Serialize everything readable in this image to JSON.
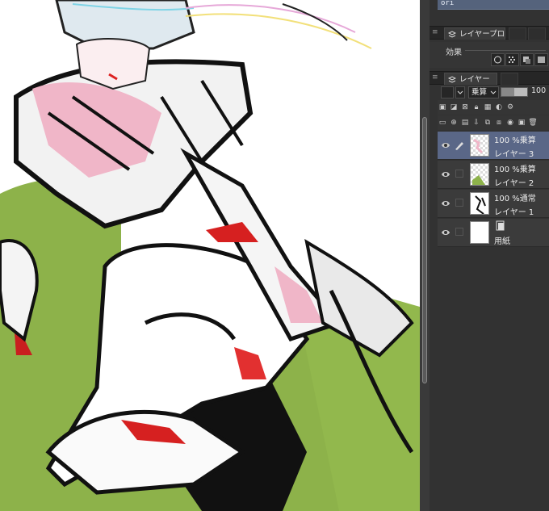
{
  "palette_top": {
    "text": "ori"
  },
  "property_panel": {
    "tab_label": "レイヤープロ",
    "effects_label": "効果"
  },
  "layer_panel": {
    "tab_label": "レイヤー",
    "blend_mode": "乗算",
    "opacity": "100"
  },
  "layers": [
    {
      "blend": "100 %乗算",
      "name": "レイヤー 3",
      "selected": true
    },
    {
      "blend": "100 %乗算",
      "name": "レイヤー 2",
      "selected": false
    },
    {
      "blend": "100 %通常",
      "name": "レイヤー 1",
      "selected": false
    },
    {
      "blend": "",
      "name": "用紙",
      "selected": false
    }
  ],
  "colors": {
    "selected_layer": "#5a6787",
    "panel_bg": "#323232",
    "canvas_green": "#8db24a",
    "canvas_pink": "#f0b6c8"
  },
  "icons": [
    "eye-icon",
    "pen-icon",
    "layers-icon",
    "paper-icon"
  ]
}
